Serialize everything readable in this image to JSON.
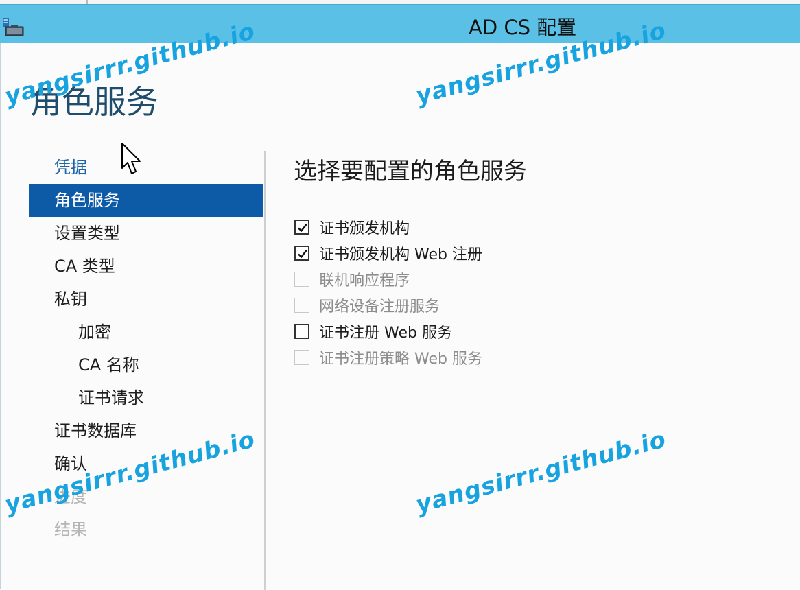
{
  "window": {
    "title": "AD CS 配置",
    "app_icon": "server-manager-icon"
  },
  "page_title": "角色服务",
  "nav": {
    "items": [
      {
        "label": "凭据",
        "state": "link"
      },
      {
        "label": "角色服务",
        "state": "selected"
      },
      {
        "label": "设置类型",
        "state": "normal"
      },
      {
        "label": "CA 类型",
        "state": "normal"
      },
      {
        "label": "私钥",
        "state": "normal"
      },
      {
        "label": "加密",
        "state": "sub"
      },
      {
        "label": "CA 名称",
        "state": "sub"
      },
      {
        "label": "证书请求",
        "state": "sub"
      },
      {
        "label": "证书数据库",
        "state": "normal"
      },
      {
        "label": "确认",
        "state": "normal"
      },
      {
        "label": "进度",
        "state": "disabled"
      },
      {
        "label": "结果",
        "state": "disabled"
      }
    ]
  },
  "content": {
    "heading": "选择要配置的角色服务",
    "services": [
      {
        "label": "证书颁发机构",
        "checked": true,
        "enabled": true
      },
      {
        "label": "证书颁发机构 Web 注册",
        "checked": true,
        "enabled": true
      },
      {
        "label": "联机响应程序",
        "checked": false,
        "enabled": false
      },
      {
        "label": "网络设备注册服务",
        "checked": false,
        "enabled": false
      },
      {
        "label": "证书注册 Web 服务",
        "checked": false,
        "enabled": true
      },
      {
        "label": "证书注册策略 Web 服务",
        "checked": false,
        "enabled": false
      }
    ]
  },
  "watermark": "yangsirrr.github.io",
  "colors": {
    "titlebar": "#5ac0e6",
    "nav_selected": "#0d5aa7",
    "nav_link": "#1d64a8",
    "page_title": "#1f4d6b",
    "watermark": "#17a3e0"
  }
}
